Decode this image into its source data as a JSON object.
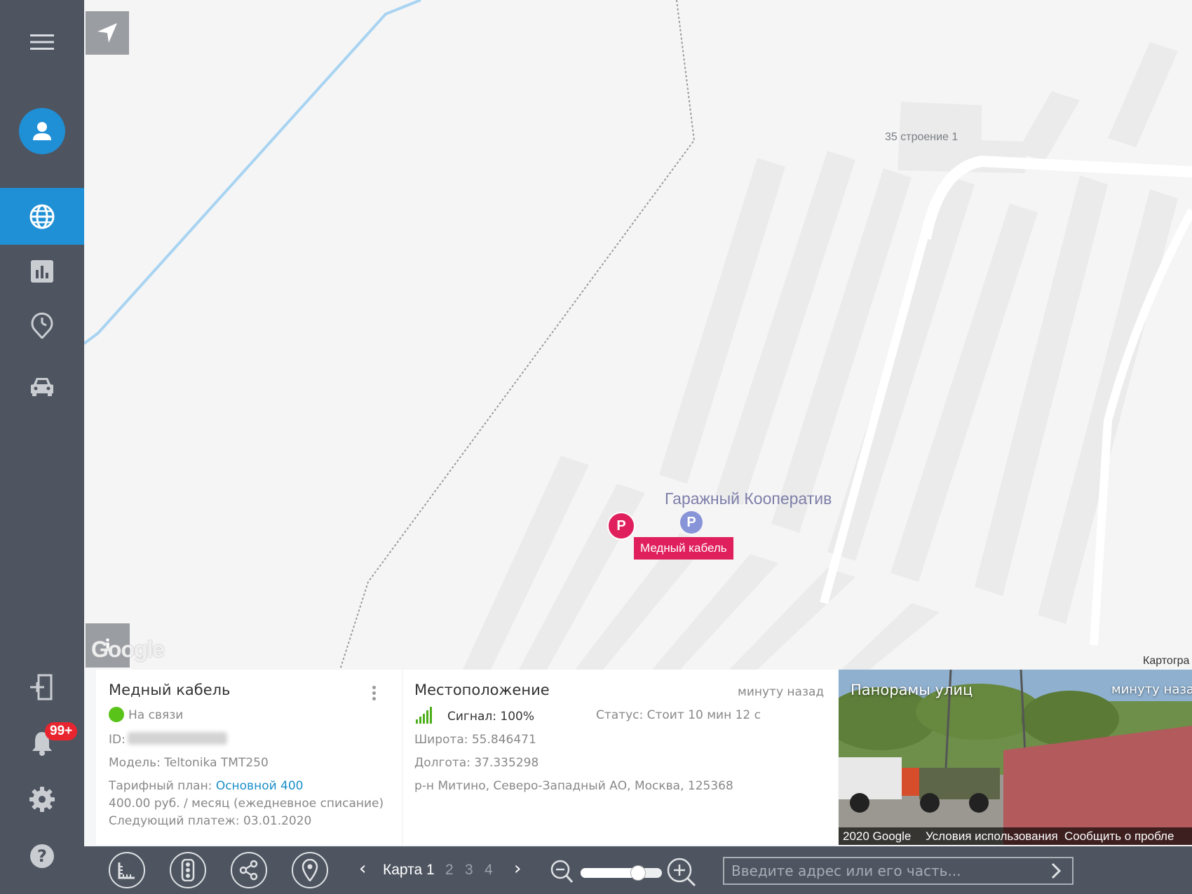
{
  "sidebar": {
    "badge": "99+"
  },
  "map": {
    "building_label": "35 строение 1",
    "poi_label": "Гаражный Кооператив",
    "parking_marker": "P",
    "vehicle_marker": "P",
    "vehicle_tag": "Медный кабель",
    "watermark": "Google",
    "cartography_label": "Картогра",
    "info_button": "i"
  },
  "device": {
    "name": "Медный кабель",
    "status": "На связи",
    "status_color": "#5ac31a",
    "id_label": "ID:",
    "model": "Модель: Teltonika TMT250",
    "tariff_label": "Тарифный план:",
    "tariff_value": "Основной 400",
    "price": "400.00 руб. / месяц (ежедневное списание)",
    "next_payment": "Следующий платеж: 03.01.2020"
  },
  "location": {
    "title": "Местоположение",
    "time": "минуту назад",
    "signal": "Сигнал: 100%",
    "status": "Статус: Стоит 10 мин 12 с",
    "latitude": "Широта: 55.846471",
    "longitude": "Долгота: 37.335298",
    "address": "р-н Митино, Северо-Западный АО, Москва, 125368"
  },
  "streetview": {
    "title": "Панорамы улиц",
    "time": "минуту назад",
    "copyright": "2020 Google",
    "terms": "Условия использования",
    "report": "Сообщить о пробле",
    "watermark": "Google"
  },
  "toolbar": {
    "prev": "‹",
    "current_map": "Карта 1",
    "pages": [
      "2",
      "3",
      "4"
    ],
    "next": "›",
    "zoom_level": 0.75,
    "search_placeholder": "Введите адрес или его часть..."
  },
  "colors": {
    "sidebar_bg": "#4e5560",
    "accent": "#1f8fd6",
    "marker": "#e0205c",
    "link": "#1a8fc9"
  }
}
